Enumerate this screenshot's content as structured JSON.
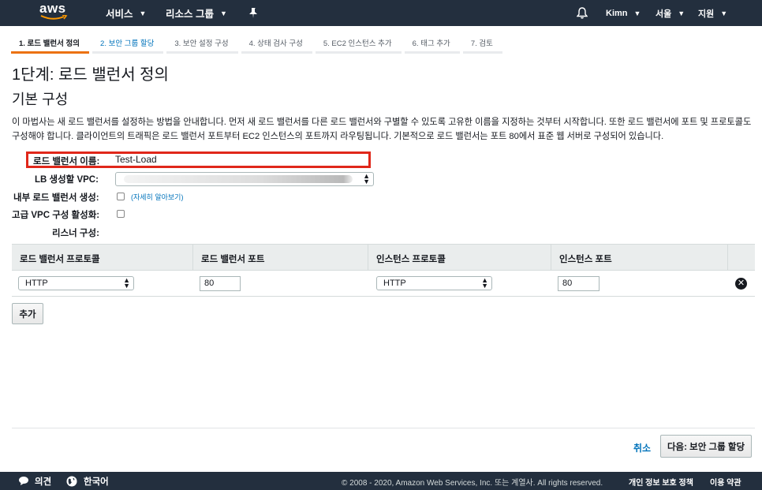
{
  "nav": {
    "logo": "aws",
    "services": "서비스",
    "resource_groups": "리소스 그룹",
    "user": "Kimn",
    "region": "서울",
    "support": "지원"
  },
  "steps": [
    {
      "label": "1. 로드 밸런서 정의",
      "state": "active"
    },
    {
      "label": "2. 보안 그룹 할당",
      "state": "next"
    },
    {
      "label": "3. 보안 설정 구성",
      "state": "todo"
    },
    {
      "label": "4. 상태 검사 구성",
      "state": "todo"
    },
    {
      "label": "5. EC2 인스턴스 추가",
      "state": "todo"
    },
    {
      "label": "6. 태그 추가",
      "state": "todo"
    },
    {
      "label": "7. 검토",
      "state": "todo"
    }
  ],
  "page": {
    "title": "1단계: 로드 밸런서 정의",
    "section": "기본 구성",
    "description": "이 마법사는 새 로드 밸런서를 설정하는 방법을 안내합니다. 먼저 새 로드 밸런서를 다른 로드 밸런서와 구별할 수 있도록 고유한 이름을 지정하는 것부터 시작합니다. 또한 로드 밸런서에 포트 및 프로토콜도 구성해야 합니다. 클라이언트의 트래픽은 로드 밸런서 포트부터 EC2 인스턴스의 포트까지 라우팅됩니다. 기본적으로 로드 밸런서는 포트 80에서 표준 웹 서버로 구성되어 있습니다."
  },
  "form": {
    "name_label": "로드 밸런서 이름:",
    "name_value": "Test-Load",
    "vpc_label": "LB 생성할 VPC:",
    "internal_label": "내부 로드 밸런서 생성:",
    "internal_checked": false,
    "learn_more": "(자세히 알아보기)",
    "advanced_vpc_label": "고급 VPC 구성 활성화:",
    "advanced_vpc_checked": false,
    "listener_label": "리스너 구성:"
  },
  "listener_table": {
    "headers": [
      "로드 밸런서 프로토콜",
      "로드 밸런서 포트",
      "인스턴스 프로토콜",
      "인스턴스 포트"
    ],
    "rows": [
      {
        "lb_protocol": "HTTP",
        "lb_port": "80",
        "instance_protocol": "HTTP",
        "instance_port": "80"
      }
    ],
    "add_button": "추가"
  },
  "actions": {
    "cancel": "취소",
    "next": "다음: 보안 그룹 할당"
  },
  "footer": {
    "feedback": "의견",
    "language": "한국어",
    "copyright": "© 2008 - 2020, Amazon Web Services, Inc. 또는 계열사. All rights reserved.",
    "privacy": "개인 정보 보호 정책",
    "terms": "이용 약관"
  },
  "colors": {
    "nav_bg": "#232f3e",
    "active_step_underline": "#ec7211",
    "link": "#0073bb",
    "highlight_box": "#e0271a"
  }
}
